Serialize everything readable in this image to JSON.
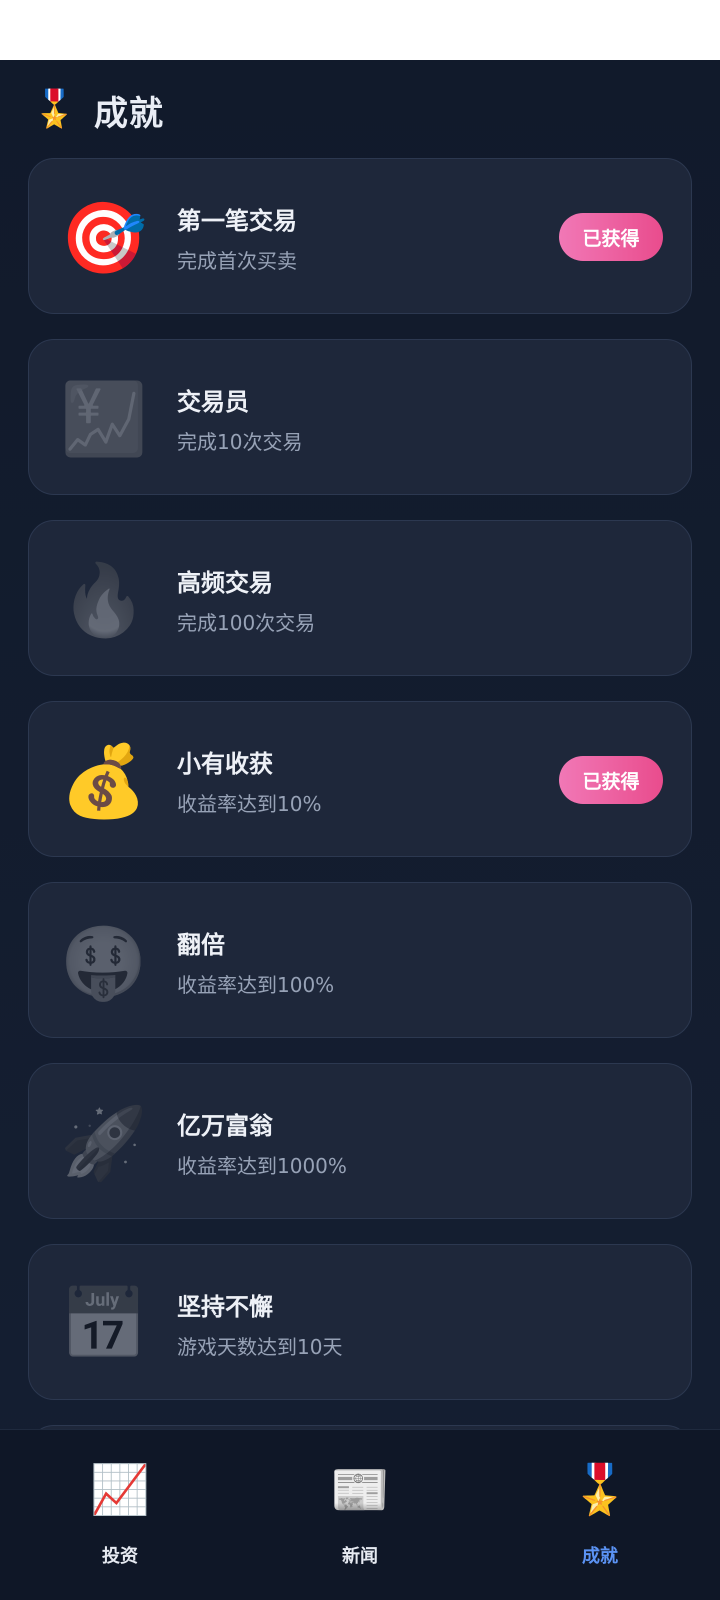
{
  "header": {
    "icon": "🎖️",
    "title": "成就"
  },
  "achievements": [
    {
      "icon": "🎯",
      "name": "第一笔交易",
      "desc": "完成首次买卖",
      "earned": true,
      "badge": "已获得"
    },
    {
      "icon": "💹",
      "name": "交易员",
      "desc": "完成10次交易",
      "earned": false
    },
    {
      "icon": "🔥",
      "name": "高频交易",
      "desc": "完成100次交易",
      "earned": false
    },
    {
      "icon": "💰",
      "name": "小有收获",
      "desc": "收益率达到10%",
      "earned": true,
      "badge": "已获得"
    },
    {
      "icon": "🤑",
      "name": "翻倍",
      "desc": "收益率达到100%",
      "earned": false
    },
    {
      "icon": "🚀",
      "name": "亿万富翁",
      "desc": "收益率达到1000%",
      "earned": false
    },
    {
      "icon": "📅",
      "name": "坚持不懈",
      "desc": "游戏天数达到10天",
      "earned": false
    }
  ],
  "nav": {
    "items": [
      {
        "icon": "📈",
        "label": "投资",
        "active": false
      },
      {
        "icon": "📰",
        "label": "新闻",
        "active": false
      },
      {
        "icon": "🎖️",
        "label": "成就",
        "active": true
      }
    ],
    "active_color": "#5b93f4"
  },
  "colors": {
    "badge": "#ee5f9f",
    "card_bg": "#1e273a",
    "page_bg": "#131c2e"
  }
}
